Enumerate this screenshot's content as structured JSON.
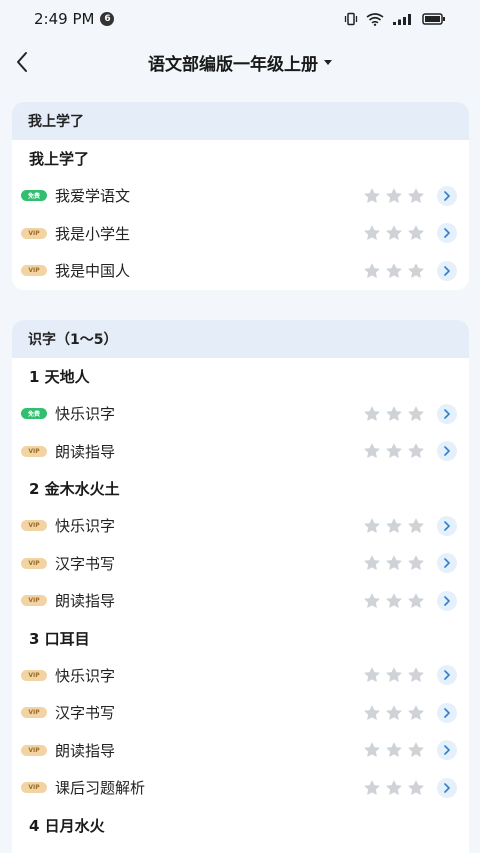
{
  "status": {
    "time": "2:49 PM",
    "notif_count": "6"
  },
  "header": {
    "title": "语文部编版一年级上册"
  },
  "cards": [
    {
      "heading": "我上学了",
      "groups": [
        {
          "title": "我上学了",
          "lessons": [
            {
              "tag": "免费",
              "type": "free",
              "label": "我爱学语文",
              "stars": 0
            },
            {
              "tag": "VIP",
              "type": "vip",
              "label": "我是小学生",
              "stars": 0
            },
            {
              "tag": "VIP",
              "type": "vip",
              "label": "我是中国人",
              "stars": 0
            }
          ]
        }
      ]
    },
    {
      "heading": "识字（1～5）",
      "groups": [
        {
          "title": "1 天地人",
          "lessons": [
            {
              "tag": "免费",
              "type": "free",
              "label": "快乐识字",
              "stars": 0
            },
            {
              "tag": "VIP",
              "type": "vip",
              "label": "朗读指导",
              "stars": 0
            }
          ]
        },
        {
          "title": "2 金木水火土",
          "lessons": [
            {
              "tag": "VIP",
              "type": "vip",
              "label": "快乐识字",
              "stars": 0
            },
            {
              "tag": "VIP",
              "type": "vip",
              "label": "汉字书写",
              "stars": 0
            },
            {
              "tag": "VIP",
              "type": "vip",
              "label": "朗读指导",
              "stars": 0
            }
          ]
        },
        {
          "title": "3 口耳目",
          "lessons": [
            {
              "tag": "VIP",
              "type": "vip",
              "label": "快乐识字",
              "stars": 0
            },
            {
              "tag": "VIP",
              "type": "vip",
              "label": "汉字书写",
              "stars": 0
            },
            {
              "tag": "VIP",
              "type": "vip",
              "label": "朗读指导",
              "stars": 0
            },
            {
              "tag": "VIP",
              "type": "vip",
              "label": "课后习题解析",
              "stars": 0
            }
          ]
        },
        {
          "title": "4 日月水火",
          "lessons": []
        }
      ]
    }
  ],
  "icons": {
    "back": "chevron-left-icon",
    "dropdown": "caret-down-icon",
    "star": "star-outline-icon",
    "arrow": "chevron-right-icon"
  },
  "colors": {
    "free_tag": "#2fbf6f",
    "vip_tag": "#f2d3a3",
    "card_header": "#e4edf8",
    "star_empty": "#cfd3d8",
    "arrow_accent": "#2f7fd6"
  }
}
